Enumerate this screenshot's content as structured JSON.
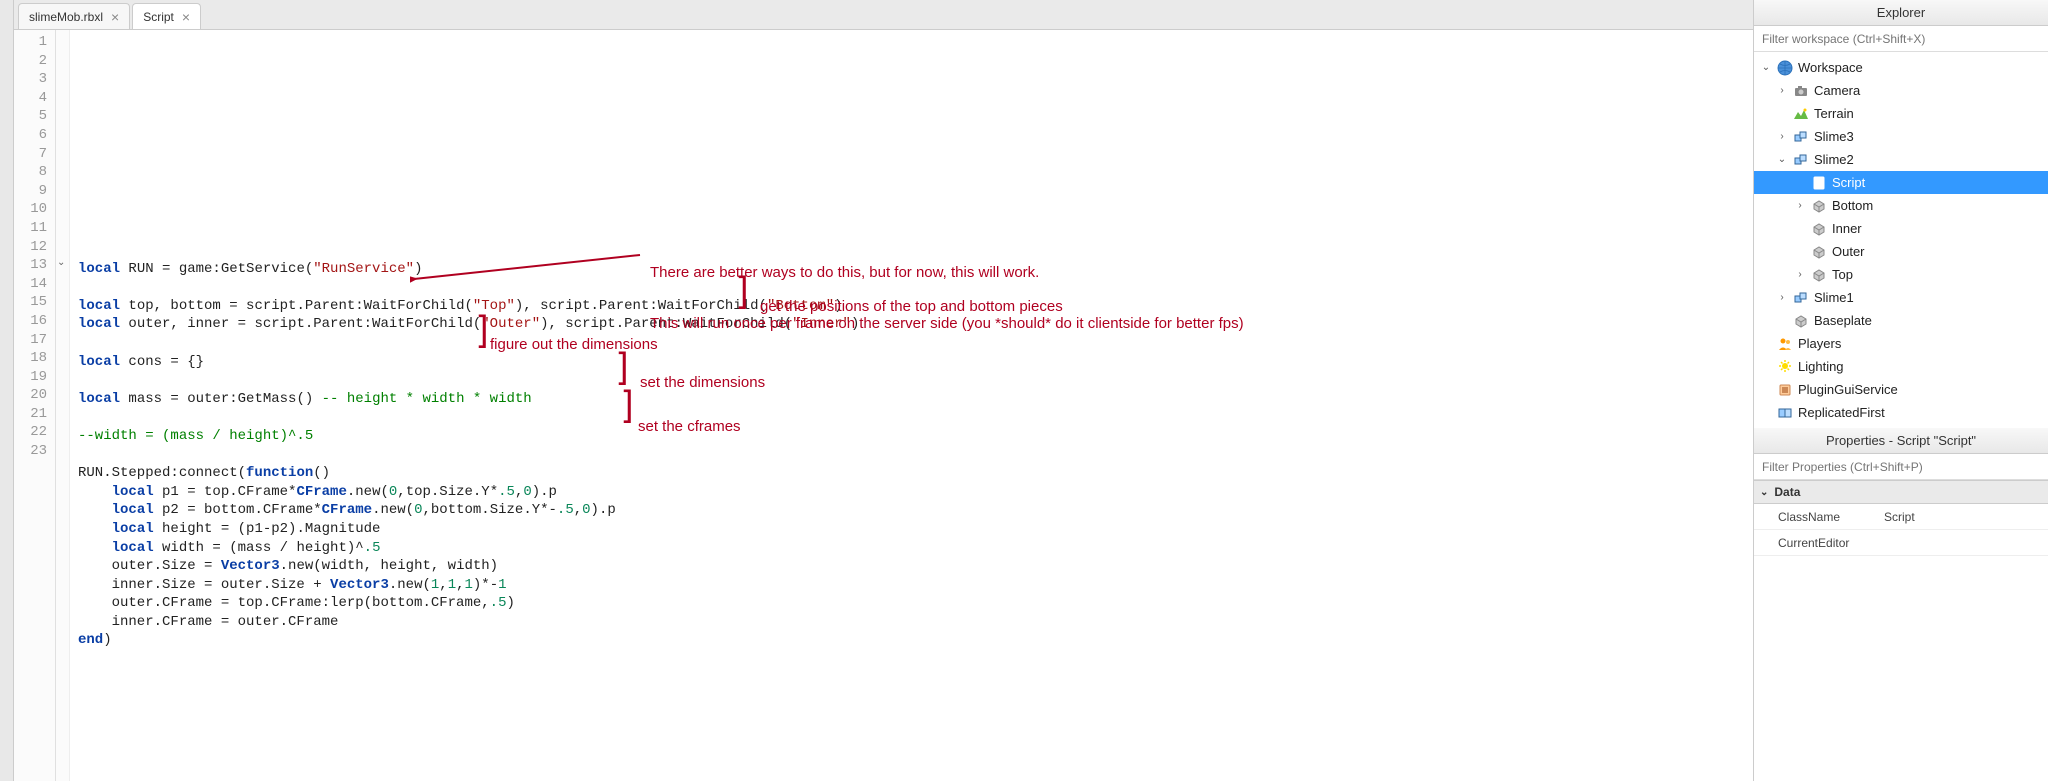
{
  "tabs": [
    {
      "label": "slimeMob.rbxl",
      "active": false
    },
    {
      "label": "Script",
      "active": true
    }
  ],
  "code": {
    "lines": [
      {
        "n": 1,
        "html": ""
      },
      {
        "n": 2,
        "html": "<span class='kw'>local</span> RUN = game:GetService(<span class='str'>\"RunService\"</span>)"
      },
      {
        "n": 3,
        "html": ""
      },
      {
        "n": 4,
        "html": "<span class='kw'>local</span> top, bottom = script.Parent:WaitForChild(<span class='str'>\"Top\"</span>), script.Parent:WaitForChild(<span class='str'>\"Bottom\"</span>)"
      },
      {
        "n": 5,
        "html": "<span class='kw'>local</span> outer, inner = script.Parent:WaitForChild(<span class='str'>\"Outer\"</span>), script.Parent:WaitForChild(<span class='str'>\"Inner\"</span>)"
      },
      {
        "n": 6,
        "html": ""
      },
      {
        "n": 7,
        "html": "<span class='kw'>local</span> cons = {}"
      },
      {
        "n": 8,
        "html": ""
      },
      {
        "n": 9,
        "html": "<span class='kw'>local</span> mass = outer:GetMass() <span class='cm'>-- height * width * width</span>"
      },
      {
        "n": 10,
        "html": ""
      },
      {
        "n": 11,
        "html": "<span class='cm'>--width = (mass / height)^.5</span>"
      },
      {
        "n": 12,
        "html": ""
      },
      {
        "n": 13,
        "html": "RUN.Stepped:connect(<span class='kw'>function</span>()"
      },
      {
        "n": 14,
        "html": "    <span class='kw'>local</span> p1 = top.CFrame*<span class='typ'>CFrame</span>.new(<span class='num'>0</span>,top.Size.Y*<span class='num'>.5</span>,<span class='num'>0</span>).p"
      },
      {
        "n": 15,
        "html": "    <span class='kw'>local</span> p2 = bottom.CFrame*<span class='typ'>CFrame</span>.new(<span class='num'>0</span>,bottom.Size.Y*-<span class='num'>.5</span>,<span class='num'>0</span>).p"
      },
      {
        "n": 16,
        "html": "    <span class='kw'>local</span> height = (p1-p2).Magnitude"
      },
      {
        "n": 17,
        "html": "    <span class='kw'>local</span> width = (mass / height)^<span class='num'>.5</span>"
      },
      {
        "n": 18,
        "html": "    outer.Size = <span class='typ'>Vector3</span>.new(width, height, width)"
      },
      {
        "n": 19,
        "html": "    inner.Size = outer.Size + <span class='typ'>Vector3</span>.new(<span class='num'>1</span>,<span class='num'>1</span>,<span class='num'>1</span>)*-<span class='num'>1</span>"
      },
      {
        "n": 20,
        "html": "    outer.CFrame = top.CFrame:lerp(bottom.CFrame,<span class='num'>.5</span>)"
      },
      {
        "n": 21,
        "html": "    inner.CFrame = outer.CFrame"
      },
      {
        "n": 22,
        "html": "<span class='kw'>end</span>)"
      },
      {
        "n": 23,
        "html": ""
      }
    ]
  },
  "annotations": {
    "a1_l1": "There are better ways to do this, but for now, this will work.",
    "a1_l2": "This will run once per frame on the server side (you *should* do it clientside for better fps)",
    "a2": "get the positions of the top and bottom pieces",
    "a3": "figure out the dimensions",
    "a4": "set the dimensions",
    "a5": "set the cframes"
  },
  "explorer": {
    "title": "Explorer",
    "filter_placeholder": "Filter workspace (Ctrl+Shift+X)",
    "tree": [
      {
        "label": "Workspace",
        "icon": "globe",
        "indent": 0,
        "expand": "open"
      },
      {
        "label": "Camera",
        "icon": "camera",
        "indent": 1,
        "expand": "closed"
      },
      {
        "label": "Terrain",
        "icon": "terrain",
        "indent": 1,
        "expand": "none"
      },
      {
        "label": "Slime3",
        "icon": "model",
        "indent": 1,
        "expand": "closed"
      },
      {
        "label": "Slime2",
        "icon": "model",
        "indent": 1,
        "expand": "open"
      },
      {
        "label": "Script",
        "icon": "script",
        "indent": 2,
        "expand": "none",
        "selected": true
      },
      {
        "label": "Bottom",
        "icon": "part",
        "indent": 2,
        "expand": "closed"
      },
      {
        "label": "Inner",
        "icon": "part",
        "indent": 2,
        "expand": "none"
      },
      {
        "label": "Outer",
        "icon": "part",
        "indent": 2,
        "expand": "none"
      },
      {
        "label": "Top",
        "icon": "part",
        "indent": 2,
        "expand": "closed"
      },
      {
        "label": "Slime1",
        "icon": "model",
        "indent": 1,
        "expand": "closed"
      },
      {
        "label": "Baseplate",
        "icon": "part",
        "indent": 1,
        "expand": "none"
      },
      {
        "label": "Players",
        "icon": "players",
        "indent": 0,
        "expand": "none"
      },
      {
        "label": "Lighting",
        "icon": "lighting",
        "indent": 0,
        "expand": "none"
      },
      {
        "label": "PluginGuiService",
        "icon": "plugin",
        "indent": 0,
        "expand": "none"
      },
      {
        "label": "ReplicatedFirst",
        "icon": "replicated",
        "indent": 0,
        "expand": "none"
      }
    ]
  },
  "properties": {
    "title": "Properties - Script \"Script\"",
    "filter_placeholder": "Filter Properties (Ctrl+Shift+P)",
    "section": "Data",
    "rows": [
      {
        "name": "ClassName",
        "value": "Script"
      },
      {
        "name": "CurrentEditor",
        "value": ""
      }
    ]
  }
}
